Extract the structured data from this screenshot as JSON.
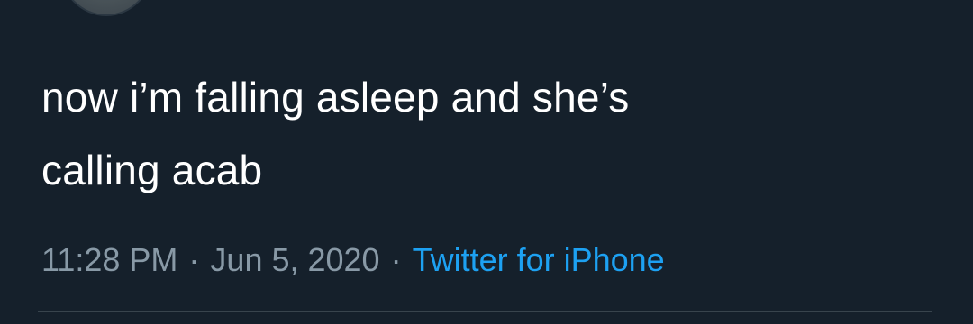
{
  "tweet": {
    "line1": "now i’m falling asleep and she’s",
    "line2": "calling acab"
  },
  "meta": {
    "time": "11:28 PM",
    "separator": "·",
    "date": "Jun 5, 2020",
    "source": "Twitter for iPhone"
  },
  "colors": {
    "background": "#15202b",
    "text": "#ffffff",
    "meta_text": "#8899a6",
    "link": "#1da1f2",
    "divider": "#38444d"
  }
}
